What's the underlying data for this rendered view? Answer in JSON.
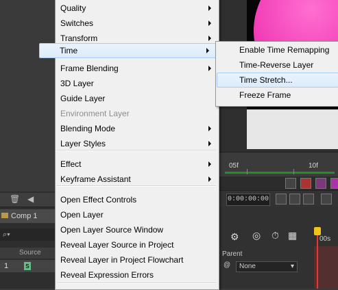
{
  "app": {
    "comp_tab": "Comp 1",
    "ruler_labels": [
      "05f",
      "10f"
    ],
    "timecode": "0:00:00:00",
    "timeline_time": "00s",
    "search_placeholder": "",
    "column_header_left": "Source",
    "layer_source_initial": "s",
    "parent_header": "Parent",
    "parent_value": "None",
    "accent_color": "#f23fb8"
  },
  "menu": {
    "items": [
      {
        "label": "Quality",
        "submenu": true
      },
      {
        "label": "Switches",
        "submenu": true
      },
      {
        "label": "Transform",
        "submenu": true
      },
      {
        "label": "Time",
        "submenu": true,
        "highlighted": true
      },
      {
        "label": "Frame Blending",
        "submenu": true
      },
      {
        "label": "3D Layer",
        "submenu": false
      },
      {
        "label": "Guide Layer",
        "submenu": false
      },
      {
        "label": "Environment Layer",
        "submenu": false,
        "disabled": true
      },
      {
        "label": "Blending Mode",
        "submenu": true
      },
      {
        "label": "Layer Styles",
        "submenu": true
      },
      {
        "label": "Effect",
        "submenu": true
      },
      {
        "label": "Keyframe Assistant",
        "submenu": true
      },
      {
        "label": "Open Effect Controls",
        "submenu": false
      },
      {
        "label": "Open Layer",
        "submenu": false
      },
      {
        "label": "Open Layer Source Window",
        "submenu": false
      },
      {
        "label": "Reveal Layer Source in Project",
        "submenu": false
      },
      {
        "label": "Reveal Layer in Project Flowchart",
        "submenu": false
      },
      {
        "label": "Reveal Expression Errors",
        "submenu": false
      }
    ]
  },
  "submenu": {
    "items": [
      {
        "label": "Enable Time Remapping"
      },
      {
        "label": "Time-Reverse Layer"
      },
      {
        "label": "Time Stretch...",
        "highlighted": true
      },
      {
        "label": "Freeze Frame"
      }
    ]
  }
}
